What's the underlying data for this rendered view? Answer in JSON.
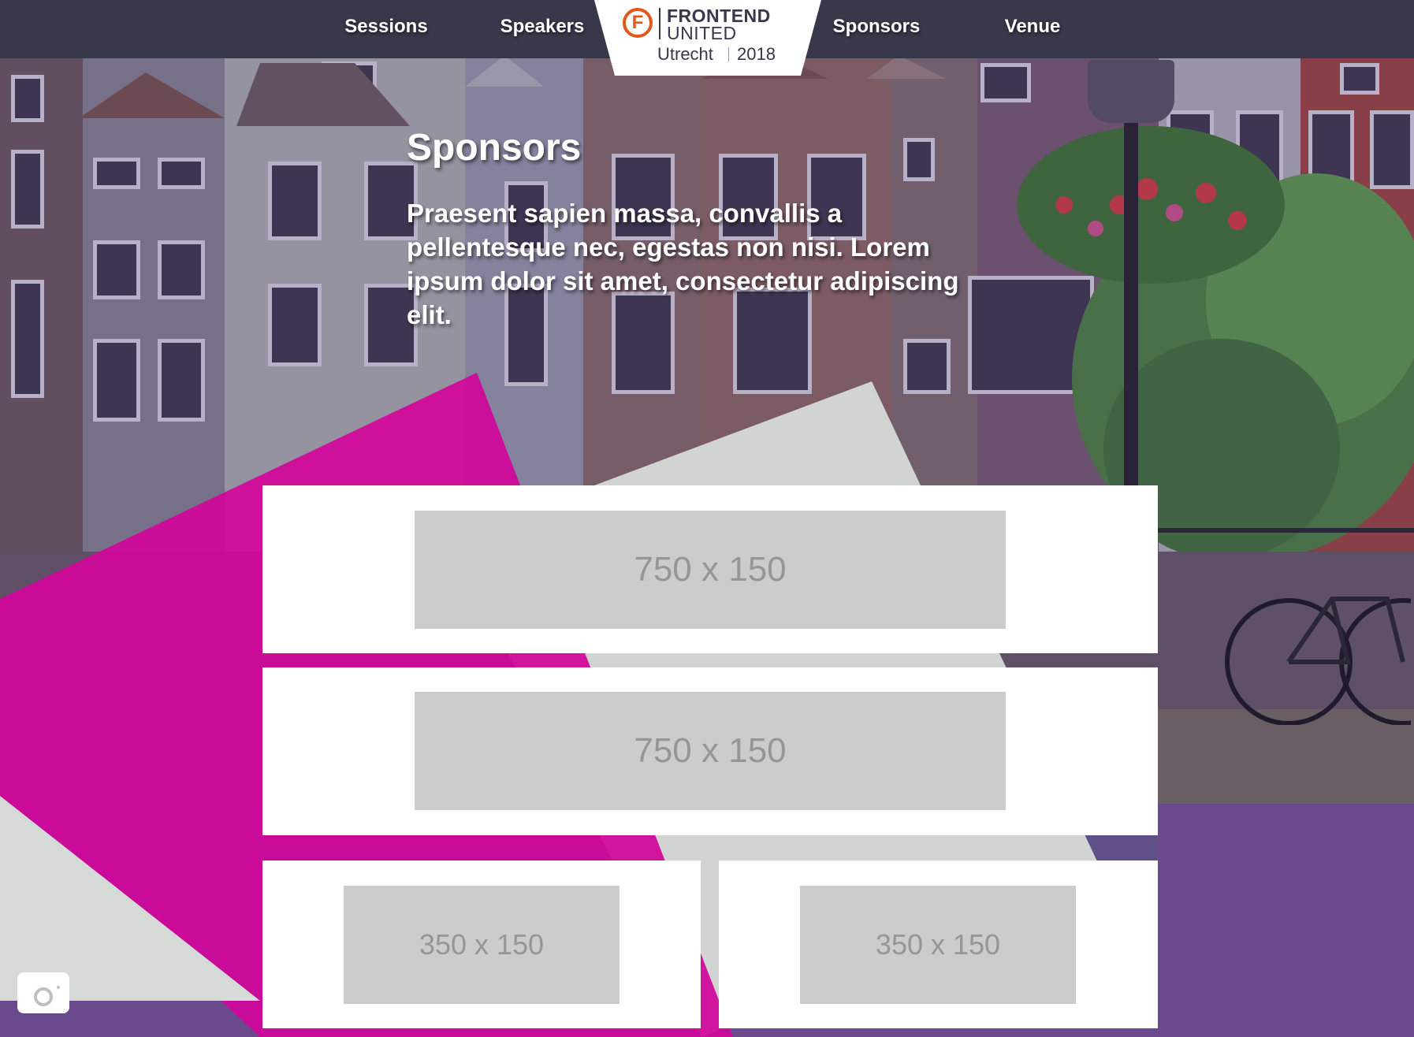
{
  "nav": {
    "links": [
      "Sessions",
      "Speakers",
      "Sponsors",
      "Venue"
    ],
    "logo": {
      "mark": "F",
      "line1": "FRONTEND",
      "line2": "UNITED",
      "city": "Utrecht",
      "year": "2018"
    }
  },
  "hero": {
    "title": "Sponsors",
    "intro": "Praesent sapien massa, convallis a pellentesque nec, egestas non nisi. Lorem ipsum dolor sit amet, consectetur adipiscing elit."
  },
  "sponsors": {
    "large": [
      {
        "label": "750 x 150"
      },
      {
        "label": "750 x 150"
      }
    ],
    "small": [
      {
        "label": "350 x 150"
      },
      {
        "label": "350 x 150"
      }
    ]
  },
  "icons": {
    "logo": "frontend-united-logo-icon",
    "camera": "camera-icon"
  },
  "colors": {
    "navbar": "#373849",
    "magenta": "#d2069b",
    "purple": "#6a4a8d",
    "light_gray": "#d5dad6",
    "logo_orange": "#e4571c",
    "placeholder": "#cccccc",
    "placeholder_text": "#969696"
  }
}
